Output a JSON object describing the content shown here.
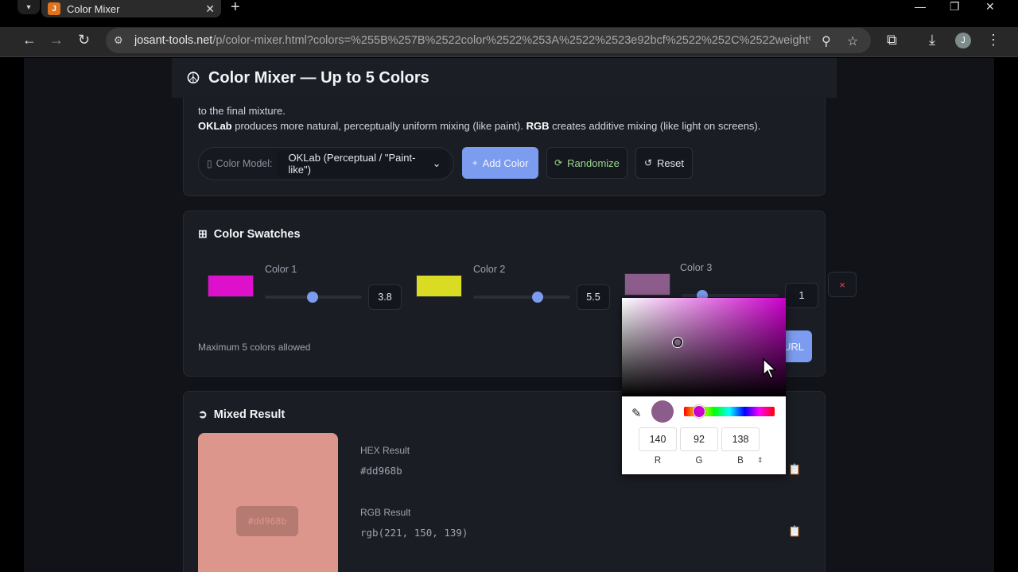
{
  "browser": {
    "tab_title": "Color Mixer",
    "tab_favicon": "josant-favicon",
    "new_tab": "+",
    "url_host": "josant-tools.net",
    "url_rest": "/p/color-mixer.html?colors=%255B%257B%2522color%2522%253A%2522%2523e92bcf%2522%252C%2522weight%2522%...",
    "profile_initial": "J"
  },
  "app": {
    "title": "Color Mixer — Up to 5 Colors",
    "logo_icon": "peace-icon"
  },
  "controls": {
    "desc_line1": "to the final mixture.",
    "desc_line2_b1": "OKLab",
    "desc_line2_t1": " produces more natural, perceptually uniform mixing (like paint). ",
    "desc_line2_b2": "RGB",
    "desc_line2_t2": " creates additive mixing (like light on screens).",
    "model_label": "Color Model:",
    "model_value": "OKLab (Perceptual / \"Paint-like\")",
    "add_color": "Add Color",
    "randomize": "Randomize",
    "reset": "Reset"
  },
  "swatches": {
    "title": "Color Swatches",
    "items": [
      {
        "name": "Color 1",
        "color": "#dd11cc",
        "weight": "3.8",
        "slider_fraction": 0.38
      },
      {
        "name": "Color 2",
        "color": "#d9dc22",
        "weight": "5.5",
        "slider_fraction": 0.55
      },
      {
        "name": "Color 3",
        "color": "#8c5c8a",
        "weight": "1",
        "slider_fraction": 0.1
      }
    ],
    "remove_icon": "×",
    "max_note": "Maximum 5 colors allowed",
    "share_button_partial": "URL"
  },
  "result": {
    "title": "Mixed Result",
    "color": "#dd968b",
    "badge_text": "#dd968b",
    "hex_label": "HEX Result",
    "hex_value": "#dd968b",
    "rgb_label": "RGB Result",
    "rgb_value": "rgb(221, 150, 139)"
  },
  "picker": {
    "preview_color": "#8c5c8a",
    "r": "140",
    "g": "92",
    "b": "138",
    "r_label": "R",
    "g_label": "G",
    "b_label": "B",
    "mode_toggle": "⇕"
  },
  "colors": {
    "accent": "#7c9cf0",
    "randomize_green": "#9ad88a",
    "danger": "#ef4444"
  }
}
